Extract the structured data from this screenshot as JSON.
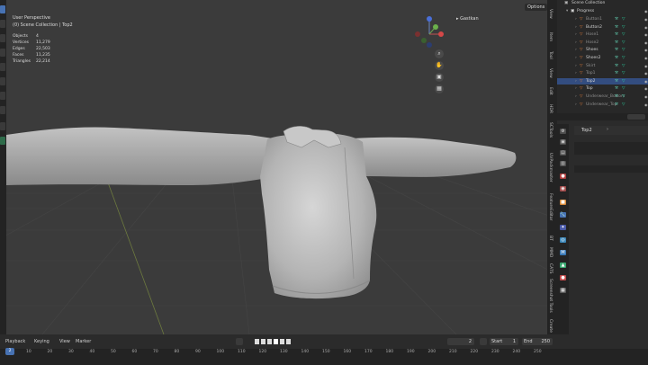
{
  "viewport": {
    "view_name": "User Perspective",
    "collection": "(0) Scene Collection | Top2",
    "stats": [
      {
        "label": "Objects",
        "value": "4"
      },
      {
        "label": "Vertices",
        "value": "11,279"
      },
      {
        "label": "Edges",
        "value": "22,503"
      },
      {
        "label": "Faces",
        "value": "11,235"
      },
      {
        "label": "Triangles",
        "value": "22,214"
      }
    ],
    "options_label": "Options",
    "gizmo_label": "Gastkan",
    "gizmo_axes": {
      "x": "X",
      "y": "Y",
      "z": "Z"
    },
    "nav_icons": [
      "zoom-icon",
      "hand-icon",
      "camera-icon",
      "grid-icon"
    ]
  },
  "sidebar_tabs": [
    "View",
    "Item",
    "Tool",
    "View",
    "Edit",
    "HDR",
    "SCTools",
    "UVPackmaster",
    "FeatureEditor",
    "BT",
    "MMD",
    "CATS",
    "Screenshot Tools",
    "Create"
  ],
  "outliner": {
    "top_label": "Scene Collection",
    "collection": "Progress",
    "items": [
      {
        "name": "Button1",
        "dim": true
      },
      {
        "name": "Button2",
        "dim": false
      },
      {
        "name": "Hose1",
        "dim": true
      },
      {
        "name": "Hose2",
        "dim": true
      },
      {
        "name": "Shoes",
        "dim": false
      },
      {
        "name": "Shoes2",
        "dim": false
      },
      {
        "name": "Skirt",
        "dim": true
      },
      {
        "name": "Top1",
        "dim": true
      },
      {
        "name": "Top2",
        "dim": false,
        "selected": true
      },
      {
        "name": "Top",
        "dim": false
      },
      {
        "name": "Underwear_Bottom",
        "dim": true
      },
      {
        "name": "Underwear_Top",
        "dim": true
      }
    ]
  },
  "properties": {
    "object_name": "Top2"
  },
  "timeline": {
    "menus": [
      "Playback",
      "Keying",
      "View",
      "Marker"
    ],
    "current_frame": "2",
    "start_label": "Start",
    "start_value": "1",
    "end_label": "End",
    "end_value": "250",
    "ticks": [
      "2",
      "10",
      "20",
      "30",
      "40",
      "50",
      "60",
      "70",
      "80",
      "90",
      "100",
      "110",
      "120",
      "130",
      "140",
      "150",
      "160",
      "170",
      "180",
      "190",
      "200",
      "210",
      "220",
      "230",
      "240",
      "250"
    ]
  },
  "colors": {
    "accent": "#4772b3",
    "viewport_bg": "#3b3b3b",
    "panel_bg": "#282828",
    "object_orange": "#e07b39",
    "modifier_teal": "#2bd3a0"
  }
}
